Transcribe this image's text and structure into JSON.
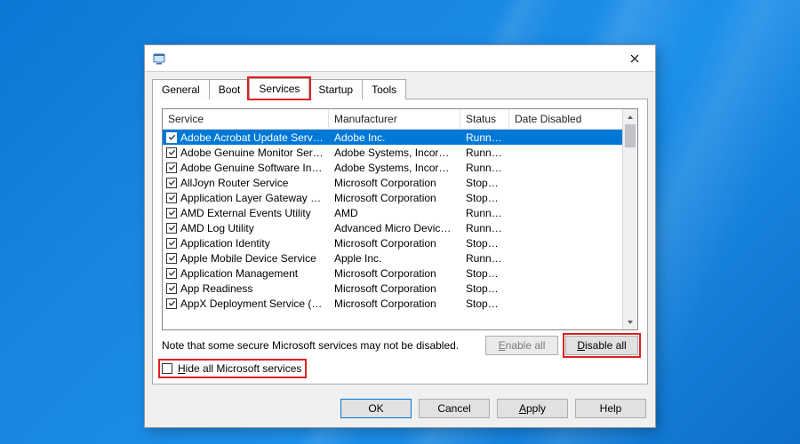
{
  "window": {
    "close_tooltip": "Close"
  },
  "tabs": [
    "General",
    "Boot",
    "Services",
    "Startup",
    "Tools"
  ],
  "active_tab_index": 2,
  "columns": {
    "service": "Service",
    "manufacturer": "Manufacturer",
    "status": "Status",
    "date_disabled": "Date Disabled"
  },
  "services": [
    {
      "checked": true,
      "name": "Adobe Acrobat Update Service",
      "mfr": "Adobe Inc.",
      "status": "Running",
      "selected": true
    },
    {
      "checked": true,
      "name": "Adobe Genuine Monitor Service",
      "mfr": "Adobe Systems, Incorpora...",
      "status": "Running"
    },
    {
      "checked": true,
      "name": "Adobe Genuine Software Integri...",
      "mfr": "Adobe Systems, Incorpora...",
      "status": "Running"
    },
    {
      "checked": true,
      "name": "AllJoyn Router Service",
      "mfr": "Microsoft Corporation",
      "status": "Stopped"
    },
    {
      "checked": true,
      "name": "Application Layer Gateway Service",
      "mfr": "Microsoft Corporation",
      "status": "Stopped"
    },
    {
      "checked": true,
      "name": "AMD External Events Utility",
      "mfr": "AMD",
      "status": "Running"
    },
    {
      "checked": true,
      "name": "AMD Log Utility",
      "mfr": "Advanced Micro Devices, I...",
      "status": "Running"
    },
    {
      "checked": true,
      "name": "Application Identity",
      "mfr": "Microsoft Corporation",
      "status": "Stopped"
    },
    {
      "checked": true,
      "name": "Apple Mobile Device Service",
      "mfr": "Apple Inc.",
      "status": "Running"
    },
    {
      "checked": true,
      "name": "Application Management",
      "mfr": "Microsoft Corporation",
      "status": "Stopped"
    },
    {
      "checked": true,
      "name": "App Readiness",
      "mfr": "Microsoft Corporation",
      "status": "Stopped"
    },
    {
      "checked": true,
      "name": "AppX Deployment Service (AppX...",
      "mfr": "Microsoft Corporation",
      "status": "Stopped"
    }
  ],
  "note": "Note that some secure Microsoft services may not be disabled.",
  "buttons": {
    "enable_all_prefix": "E",
    "enable_all_rest": "nable all",
    "disable_all_prefix": "D",
    "disable_all_rest": "isable all",
    "ok": "OK",
    "cancel": "Cancel",
    "apply_prefix": "A",
    "apply_rest": "pply",
    "help": "Help"
  },
  "hide_checkbox": {
    "checked": false,
    "prefix": "H",
    "rest": "ide all Microsoft services"
  }
}
